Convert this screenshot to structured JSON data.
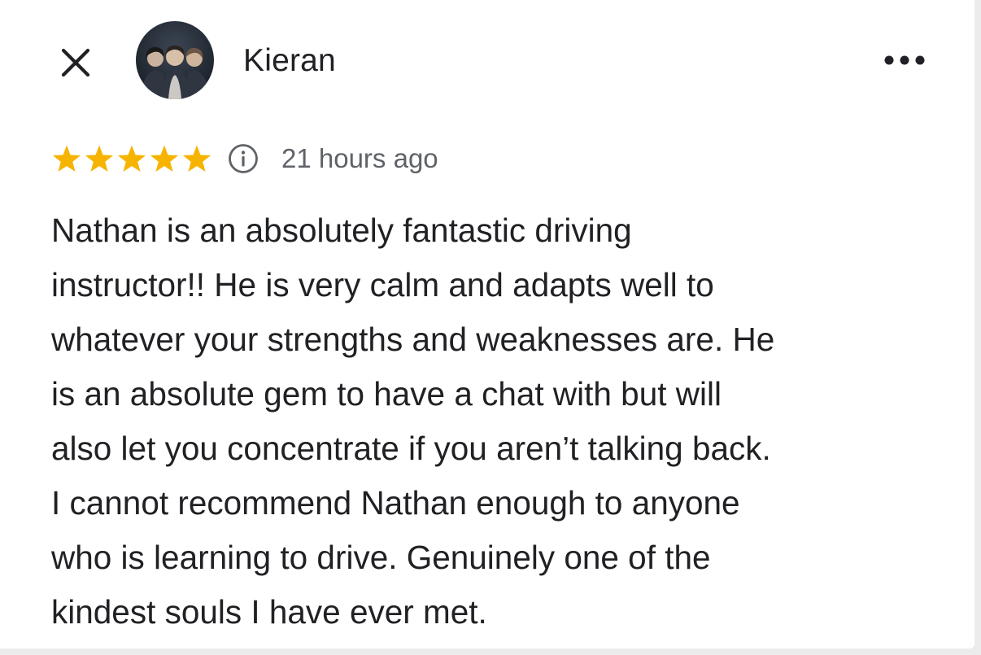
{
  "review": {
    "author": "Kieran",
    "rating": 5,
    "rating_max": 5,
    "time": "21 hours ago",
    "text_lines": [
      "Nathan is an absolutely fantastic driving",
      "instructor!! He is very calm and adapts well to",
      "whatever your strengths and weaknesses are. He",
      "is an absolute gem to have a chat with but will",
      "also let you concentrate if you aren’t talking back.",
      "I cannot recommend Nathan enough to anyone",
      "who is learning to drive. Genuinely one of the",
      "kindest souls I have ever met."
    ]
  },
  "icons": {
    "close": "close-icon",
    "more": "more-options-icon",
    "info": "info-icon",
    "star": "star-icon"
  },
  "colors": {
    "star": "#f6b400",
    "text": "#202124",
    "muted": "#5f6368"
  }
}
